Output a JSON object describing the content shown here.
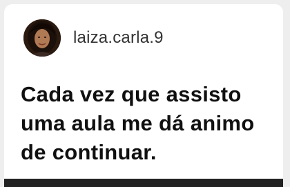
{
  "post": {
    "username": "laiza.carla.9",
    "message": "Cada vez que assisto uma aula me dá animo de continuar."
  },
  "colors": {
    "card_background": "#ffffff",
    "page_background": "#eeeeee",
    "text": "#101010",
    "bottom_bar": "#222222"
  },
  "icons": {
    "avatar": "profile-photo"
  }
}
